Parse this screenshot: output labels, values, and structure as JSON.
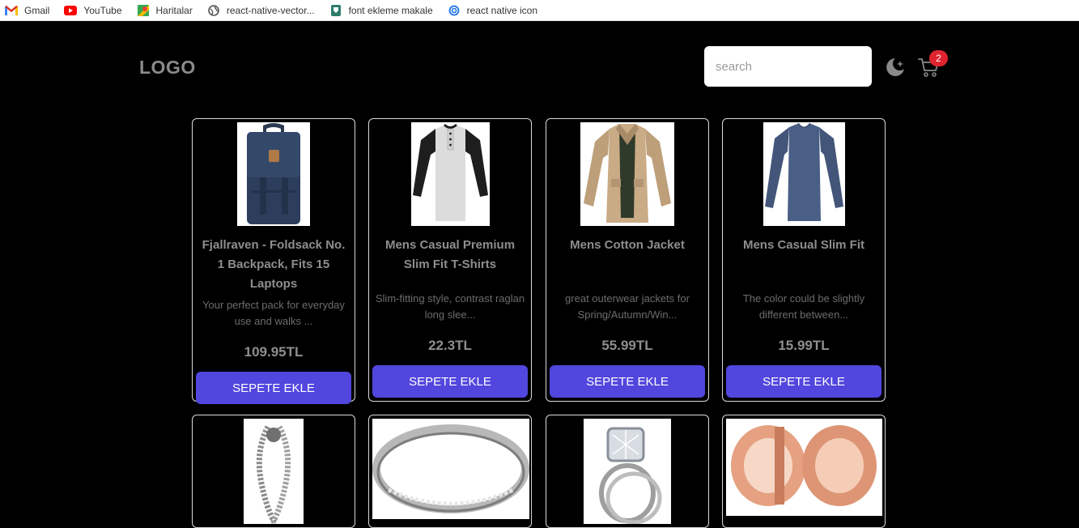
{
  "bookmarks": [
    {
      "label": "Gmail",
      "icon": "gmail-icon"
    },
    {
      "label": "YouTube",
      "icon": "youtube-icon"
    },
    {
      "label": "Haritalar",
      "icon": "maps-icon"
    },
    {
      "label": "react-native-vector...",
      "icon": "globe-icon"
    },
    {
      "label": "font ekleme makale",
      "icon": "bookmark-page-icon"
    },
    {
      "label": "react native icon",
      "icon": "swirl-icon"
    }
  ],
  "header": {
    "logo": "LOGO",
    "search_placeholder": "search",
    "cart_count": "2",
    "theme_icon": "moon-stars-icon",
    "cart_icon": "cart-icon"
  },
  "products": [
    {
      "title": "Fjallraven - Foldsack No. 1 Backpack, Fits 15 Laptops",
      "description": "Your perfect pack for everyday use and walks ...",
      "price": "109.95TL",
      "button": "SEPETE EKLE",
      "image": "backpack"
    },
    {
      "title": "Mens Casual Premium Slim Fit T-Shirts",
      "description": "Slim-fitting style, contrast raglan long slee...",
      "price": "22.3TL",
      "button": "SEPETE EKLE",
      "image": "tshirt"
    },
    {
      "title": "Mens Cotton Jacket",
      "description": "great outerwear jackets for Spring/Autumn/Win...",
      "price": "55.99TL",
      "button": "SEPETE EKLE",
      "image": "jacket"
    },
    {
      "title": "Mens Casual Slim Fit",
      "description": "The color could be slightly different between...",
      "price": "15.99TL",
      "button": "SEPETE EKLE",
      "image": "longsleeve"
    },
    {
      "image": "bracelet"
    },
    {
      "image": "silver-ring"
    },
    {
      "image": "diamond-ring"
    },
    {
      "image": "rose-gold-plugs"
    }
  ],
  "colors": {
    "accent": "#5146dd",
    "badge": "#e0242f",
    "background": "#000000"
  }
}
